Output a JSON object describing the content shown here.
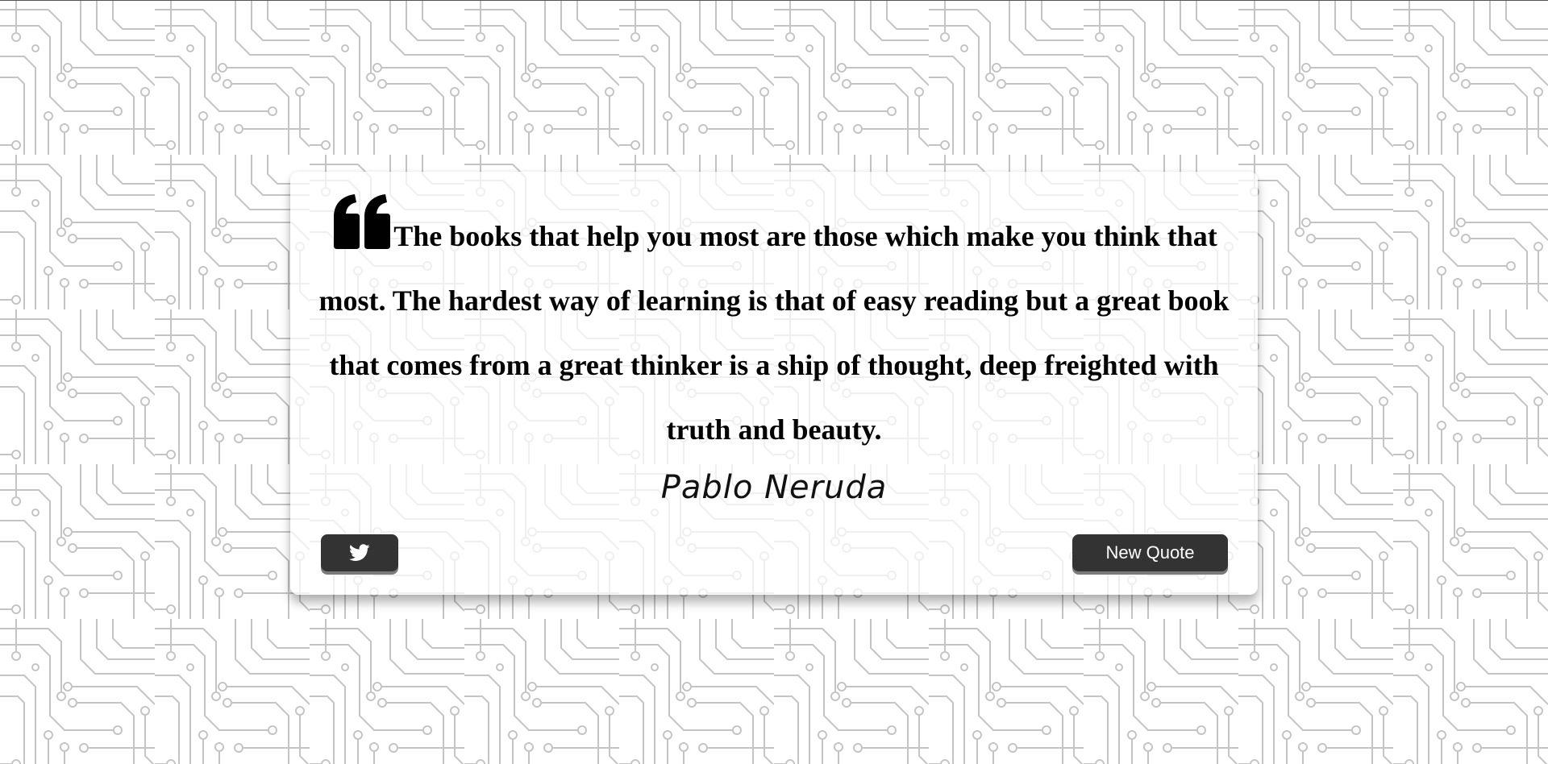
{
  "quote": {
    "text": "The books that help you most are those which make you think that most. The hardest way of learning is that of easy reading but a great book that comes from a great thinker is a ship of thought, deep freighted with truth and beauty.",
    "author": "Pablo Neruda"
  },
  "buttons": {
    "tweet_icon": "twitter-icon",
    "new_quote_label": "New Quote"
  },
  "colors": {
    "button_bg": "#333333",
    "button_text": "#ffffff",
    "circuit_lines": "#c2c2c2",
    "page_bg": "#ffffff"
  }
}
